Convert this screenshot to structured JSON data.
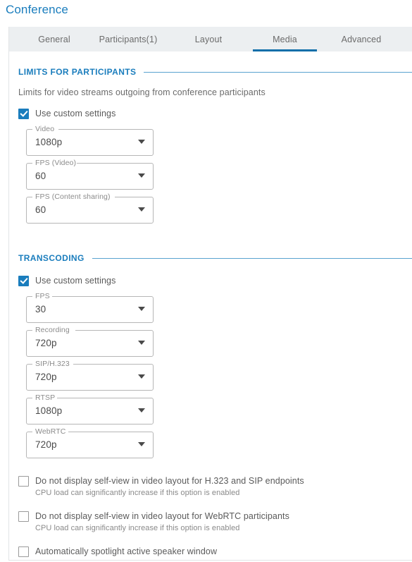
{
  "page_title": "Conference",
  "colors": {
    "accent_blue": "#1a7dbd",
    "tab_underline": "#0d6ea9",
    "tabbar_bg": "#eceff1",
    "text_gray": "#5a5a5a"
  },
  "tabs": [
    {
      "label": "General",
      "active": false
    },
    {
      "label": "Participants(1)",
      "active": false
    },
    {
      "label": "Layout",
      "active": false
    },
    {
      "label": "Media",
      "active": true
    },
    {
      "label": "Advanced",
      "active": false
    }
  ],
  "sections": {
    "limits": {
      "heading": "LIMITS FOR PARTICIPANTS",
      "description": "Limits for video streams outgoing from conference participants",
      "use_custom_label": "Use custom settings",
      "use_custom_checked": true,
      "fields": [
        {
          "label": "Video",
          "value": "1080p"
        },
        {
          "label": "FPS (Video)",
          "value": "60"
        },
        {
          "label": "FPS (Content sharing)",
          "value": "60"
        }
      ]
    },
    "transcoding": {
      "heading": "TRANSCODING",
      "use_custom_label": "Use custom settings",
      "use_custom_checked": true,
      "fields": [
        {
          "label": "FPS",
          "value": "30"
        },
        {
          "label": "Recording",
          "value": "720p"
        },
        {
          "label": "SIP/H.323",
          "value": "720p"
        },
        {
          "label": "RTSP",
          "value": "1080p"
        },
        {
          "label": "WebRTC",
          "value": "720p"
        }
      ],
      "options": [
        {
          "label": "Do not display self-view in video layout for H.323 and SIP endpoints",
          "hint": "CPU load can significantly increase if this option is enabled",
          "checked": false
        },
        {
          "label": "Do not display self-view in video layout for WebRTC participants",
          "hint": "CPU load can significantly increase if this option is enabled",
          "checked": false
        },
        {
          "label": "Automatically spotlight active speaker window",
          "hint": "",
          "checked": false
        }
      ]
    }
  }
}
